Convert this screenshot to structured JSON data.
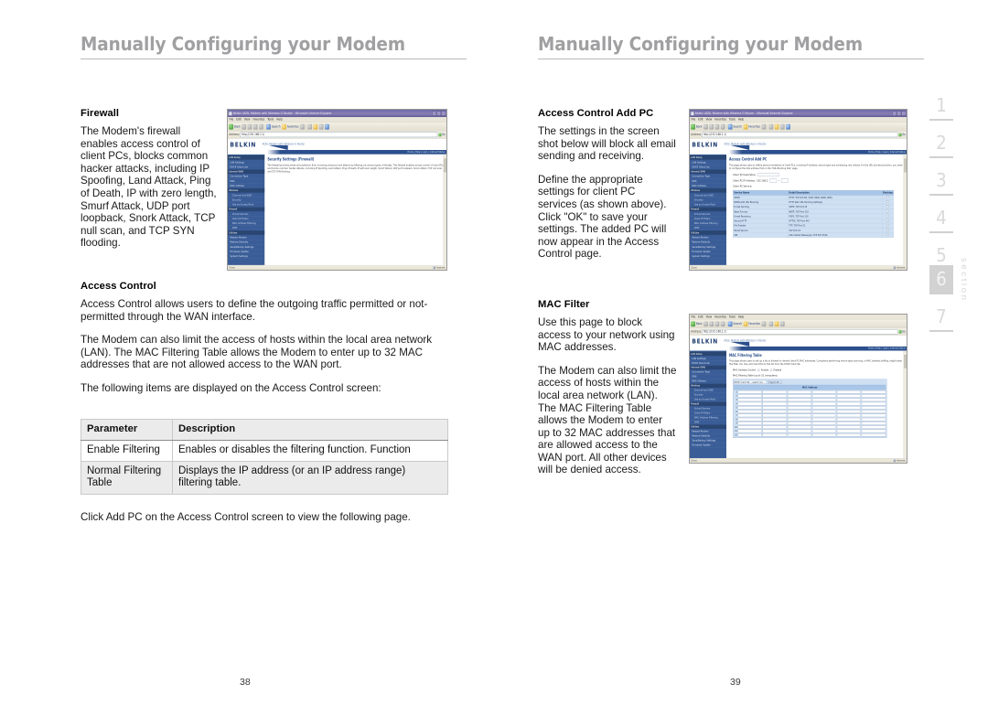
{
  "headers": {
    "left": "Manually Configuring your Modem",
    "right": "Manually Configuring your Modem"
  },
  "page_numbers": {
    "left": "38",
    "right": "39"
  },
  "section_rail": {
    "word": "section",
    "current": "6",
    "items": [
      "1",
      "2",
      "3",
      "4",
      "5",
      "6",
      "7"
    ]
  },
  "left_column": {
    "firewall": {
      "title": "Firewall",
      "paragraphs": [
        "The Modem's firewall enables access control of client PCs, blocks common hacker attacks, including IP Spoofing, Land Attack, Ping of Death, IP with zero length, Smurf Attack, UDP port loopback, Snork Attack, TCP null scan, and TCP SYN flooding."
      ]
    },
    "access_control": {
      "title": "Access Control",
      "paragraphs": [
        "Access Control allows users to define the outgoing traffic permitted or not-permitted through the WAN interface.",
        "The Modem can also limit the access of hosts within the local area network (LAN). The MAC Filtering Table allows the Modem to enter up to 32 MAC addresses that are not allowed access to the WAN port.",
        "The following items are displayed on the Access Control screen:"
      ],
      "footnote": "Click Add PC on the Access Control screen to view the following page."
    },
    "param_table": {
      "columns": [
        "Parameter",
        "Description"
      ],
      "rows": [
        [
          "Enable Filtering",
          "Enables or disables the filtering function. Function"
        ],
        [
          "Normal Filtering Table",
          "Displays the IP address (or an IP address range) filtering table."
        ]
      ]
    }
  },
  "right_column": {
    "access_control_add_pc": {
      "title": "Access Control Add PC",
      "paragraphs": [
        "The settings in the screen shot below will block all email sending and receiving.",
        "Define the appropriate settings for client PC services (as shown above). Click \"OK\" to save your settings. The added PC will now appear in the Access Control page."
      ]
    },
    "mac_filter": {
      "title": "MAC Filter",
      "paragraphs": [
        "Use this page to block access to your network using MAC addresses.",
        "The Modem can also limit the access of hosts within the local area network (LAN). The MAC Filtering Table allows the Modem to enter up to 32 MAC addresses that are allowed access to the WAN port. All other devices will be denied access."
      ]
    }
  },
  "screenshots": {
    "firewall": {
      "window_title": "Belkin ADSL Modem with Wireless G Router - Microsoft Internet Explorer",
      "menu": [
        "File",
        "Edit",
        "View",
        "Favorites",
        "Tools",
        "Help"
      ],
      "toolbar": [
        "Back",
        "Forward",
        "Stop",
        "Refresh",
        "Home",
        "Search",
        "Favorites",
        "Media",
        "History",
        "Mail",
        "Print",
        "Edit"
      ],
      "address_label": "Address",
      "address_value": "http://192.168.2.1/",
      "go_label": "Go",
      "brand": "BELKIN",
      "tagline": "ADSL Modem with Wireless G Router",
      "top_links": "Home | Help | Login | Internet Status",
      "page_title": "Security Settings (Firewall)",
      "page_text": "The firewall provides advanced protection from incoming intrusions and attacks by filtering out various types of threats. This firewall enables access control of client PCs and blocks common hacker attacks, including IP Spoofing, Land Attack, Ping of Death, IP with zero length, Smurf Attack, UDP port loopback, Snork Attack, TCP null scan, and TCP SYN flooding.",
      "nav": [
        {
          "label": "LAN Setup",
          "type": "group"
        },
        {
          "label": "LAN Settings",
          "type": "item"
        },
        {
          "label": "DHCP Client List",
          "type": "item"
        },
        {
          "label": "Internet WAN",
          "type": "group"
        },
        {
          "label": "Connection Type",
          "type": "item"
        },
        {
          "label": "DNS",
          "type": "item"
        },
        {
          "label": "MAC Address",
          "type": "item"
        },
        {
          "label": "Wireless",
          "type": "group"
        },
        {
          "label": "Channel and SSID",
          "type": "sub"
        },
        {
          "label": "Security",
          "type": "sub"
        },
        {
          "label": "Use as Access Point",
          "type": "sub"
        },
        {
          "label": "Firewall",
          "type": "group"
        },
        {
          "label": "Virtual Servers",
          "type": "item"
        },
        {
          "label": "Client IP Filters",
          "type": "item"
        },
        {
          "label": "MAC Address Filtering",
          "type": "item"
        },
        {
          "label": "DMZ",
          "type": "item"
        },
        {
          "label": "Utilities",
          "type": "group"
        },
        {
          "label": "Restart Modem",
          "type": "item"
        },
        {
          "label": "Restore Defaults",
          "type": "item"
        },
        {
          "label": "Save/Backup Settings",
          "type": "item"
        },
        {
          "label": "Firmware Update",
          "type": "item"
        },
        {
          "label": "System Settings",
          "type": "item"
        }
      ],
      "status_left": "Done",
      "status_right": "Internet"
    },
    "add_pc": {
      "window_title": "Belkin ADSL Modem with Wireless G Router - Microsoft Internet Explorer",
      "brand": "BELKIN",
      "page_title": "Access Control Add PC",
      "page_text": "This page allows users to define service limitations of client PCs, including IP address, service type and scheduling rule criteria. For the URL blocking function, you need to configure the URL address first on the \"URL Blocking Site\" page.",
      "fields": [
        {
          "label": "Client PC Description:",
          "value": ""
        },
        {
          "label": "Client PC IP Address:",
          "value": "192.168.2."
        },
        {
          "label": "Client PC Service:",
          "value": ""
        }
      ],
      "service_table": {
        "columns": [
          "Service Name",
          "Detail Description",
          "Blocking"
        ],
        "rows": [
          [
            "WWW",
            "HTTP, TCP Port 80, 3128, 8000, 8080, 8081",
            ""
          ],
          [
            "WWW with URL Blocking",
            "HTTP (Ref. URL Blocking Settings)",
            ""
          ],
          [
            "E-mail Sending",
            "SMTP, TCP Port 25",
            ""
          ],
          [
            "News Forums",
            "NNTP, TCP Port 119",
            ""
          ],
          [
            "E-mail Receiving",
            "POP3, TCP Port 110",
            ""
          ],
          [
            "Secure HTTP",
            "HTTPS, TCP Port 443",
            ""
          ],
          [
            "File Transfer",
            "FTP, TCP Port 21",
            ""
          ],
          [
            "Telnet Service",
            "TCP Port 23",
            ""
          ],
          [
            "AIM",
            "AOL Instant Messenger, TCP Port 5190",
            ""
          ]
        ]
      }
    },
    "mac_filter": {
      "window_title": "Belkin ADSL Modem with Wireless G Router - Microsoft Internet Explorer",
      "brand": "BELKIN",
      "page_title": "MAC Filtering Table",
      "page_text": "This page allows users to set up a list of allowed or denied client PC MAC addresses. Computers performing device type scanning, or MAC address sniffing, might break this filter. You may add client PCs to this list from the DHCP client list.",
      "options": [
        {
          "label": "MAC Address Control:",
          "choices": [
            "Enable",
            "Disable"
          ]
        },
        {
          "label": "MAC Filtering Table (up to 32 computers):",
          "choices": []
        }
      ],
      "dhcp_select_placeholder": "DHCP client list -- select one --",
      "copy_button": "Copy to ID --",
      "grid_header": "MAC Address",
      "row_count": 12
    }
  }
}
